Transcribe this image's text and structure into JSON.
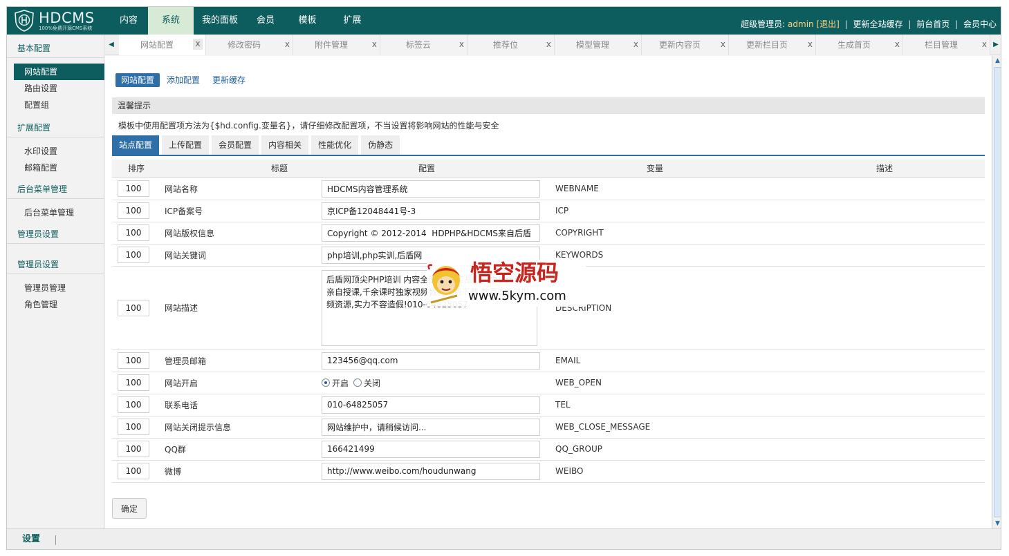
{
  "brand": {
    "name": "HDCMS",
    "slogan": "100%免费开源CMS系统",
    "color": "#0e5d5e"
  },
  "topnav": [
    "内容",
    "系统",
    "我的面板",
    "会员",
    "模板",
    "扩展"
  ],
  "userbar": {
    "role": "超级管理员:",
    "username": "admin",
    "logout": "[退出]",
    "links": [
      "更新全站缓存",
      "前台首页",
      "会员中心"
    ]
  },
  "sidebar": {
    "groups": [
      {
        "title": "基本配置",
        "items": [
          "网站配置",
          "路由设置",
          "配置组"
        ]
      },
      {
        "title": "扩展配置",
        "items": [
          "水印设置",
          "邮箱配置"
        ]
      },
      {
        "title": "后台菜单管理",
        "items": [
          "后台菜单管理"
        ]
      },
      {
        "title": "管理员设置",
        "items": []
      },
      {
        "title": "管理员设置",
        "items": [
          "管理员管理",
          "角色管理"
        ]
      }
    ]
  },
  "tabs": {
    "items": [
      "网站配置",
      "修改密码",
      "附件管理",
      "标签云",
      "推荐位",
      "模型管理",
      "更新内容页",
      "更新栏目页",
      "生成首页",
      "栏目管理"
    ],
    "close": "x"
  },
  "subnav": [
    "网站配置",
    "添加配置",
    "更新缓存"
  ],
  "tip": {
    "title": "温馨提示",
    "text": "模板中使用配置项方法为{$hd.config.变量名}，请仔细修改配置项，不当设置将影响网站的性能与安全"
  },
  "config_tabs": [
    "站点配置",
    "上传配置",
    "会员配置",
    "内容相关",
    "性能优化",
    "伪静态"
  ],
  "table": {
    "headers": [
      "排序",
      "标题",
      "配置",
      "变量",
      "描述"
    ],
    "rows": [
      {
        "order": "100",
        "title": "网站名称",
        "value": "HDCMS内容管理系统",
        "var": "WEBNAME"
      },
      {
        "order": "100",
        "title": "ICP备案号",
        "value": "京ICP备12048441号-3",
        "var": "ICP"
      },
      {
        "order": "100",
        "title": "网站版权信息",
        "value": "Copyright © 2012-2014  HDPHP&HDCMS来自后盾",
        "var": "COPYRIGHT"
      },
      {
        "order": "100",
        "title": "网站关键词",
        "value": "php培训,php实训,后盾网",
        "var": "KEYWORDS"
      },
      {
        "order": "100",
        "title": "网站描述",
        "value": "后盾网顶尖PHP培训 内容全面 全程实战！业内顶级讲师亲自授课,千余课时独家视频教程免费下载,数百G原创视频资源,实力不容造假!010-64825057",
        "var": "DESCRIPTION"
      },
      {
        "order": "100",
        "title": "管理员邮箱",
        "value": "123456@qq.com",
        "var": "EMAIL"
      },
      {
        "order": "100",
        "title": "网站开启",
        "radio_on": "开启",
        "radio_off": "关闭",
        "var": "WEB_OPEN"
      },
      {
        "order": "100",
        "title": "联系电话",
        "value": "010-64825057",
        "var": "TEL"
      },
      {
        "order": "100",
        "title": "网站关闭提示信息",
        "value": "网站维护中，请稍候访问...",
        "var": "WEB_CLOSE_MESSAGE"
      },
      {
        "order": "100",
        "title": "QQ群",
        "value": "166421499",
        "var": "QQ_GROUP"
      },
      {
        "order": "100",
        "title": "微博",
        "value": "http://www.weibo.com/houdunwang",
        "var": "WEIBO"
      }
    ]
  },
  "submit_label": "确定",
  "watermark": {
    "title": "悟空源码",
    "url": "www.5kym.com"
  },
  "bottombar": {
    "label": "设置"
  }
}
